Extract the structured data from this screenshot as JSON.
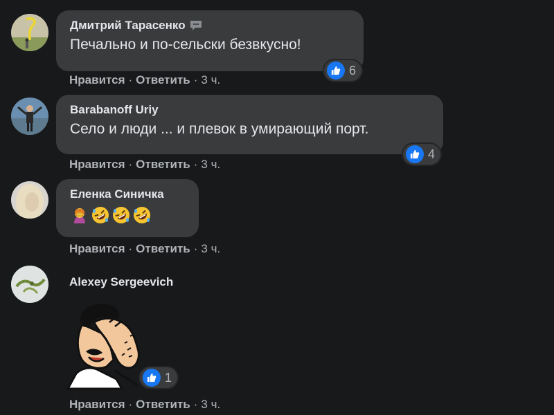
{
  "comments": [
    {
      "author": "Дмитрий Тарасенко",
      "text": "Печально и по-сельски безвкусно!",
      "reaction_count": "6",
      "actions": {
        "like": "Нравится",
        "reply": "Ответить",
        "time": "3 ч."
      },
      "icons": {
        "author_badge": "chat-bubble-icon",
        "reaction": "like-icon"
      }
    },
    {
      "author": "Barabanoff Uriy",
      "text": "Село и люди ... и плевок в умирающий порт.",
      "reaction_count": "4",
      "actions": {
        "like": "Нравится",
        "reply": "Ответить",
        "time": "3 ч."
      },
      "icons": {
        "reaction": "like-icon"
      }
    },
    {
      "author": "Еленка Синичка",
      "emojis": [
        "woman-facepalming-emoji",
        "rolling-on-floor-laughing-emoji",
        "rolling-on-floor-laughing-emoji",
        "rolling-on-floor-laughing-emoji"
      ],
      "actions": {
        "like": "Нравится",
        "reply": "Ответить",
        "time": "3 ч."
      }
    },
    {
      "author": "Alexey Sergeevich",
      "sticker": "facepalm-sticker",
      "reaction_count": "1",
      "actions": {
        "like": "Нравится",
        "reply": "Ответить",
        "time": "3 ч."
      },
      "icons": {
        "reaction": "like-icon"
      }
    }
  ],
  "colors": {
    "background": "#18191a",
    "bubble": "#3a3b3c",
    "text": "#e4e6eb",
    "secondary_text": "#b0b3b8",
    "like_blue": "#1877f2"
  }
}
